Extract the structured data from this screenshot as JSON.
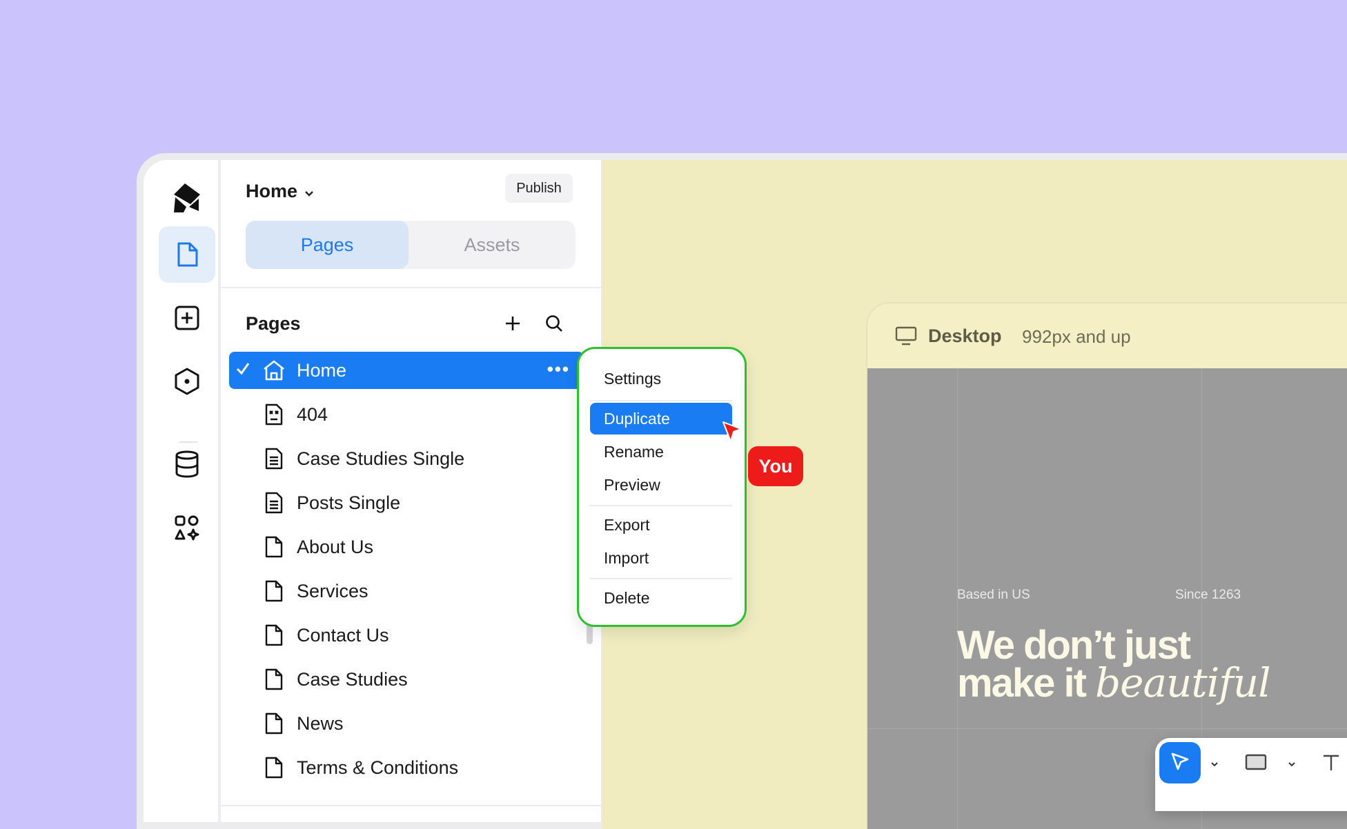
{
  "app": {
    "current_page": "Home",
    "publish_label": "Publish"
  },
  "panel": {
    "tabs": [
      {
        "label": "Pages",
        "active": true
      },
      {
        "label": "Assets",
        "active": false
      }
    ],
    "section_title": "Pages",
    "pages": [
      {
        "label": "Home",
        "icon": "home-icon",
        "selected": true
      },
      {
        "label": "404",
        "icon": "error-page-icon"
      },
      {
        "label": "Case Studies Single",
        "icon": "template-page-icon"
      },
      {
        "label": "Posts Single",
        "icon": "template-page-icon"
      },
      {
        "label": "About Us",
        "icon": "page-icon"
      },
      {
        "label": "Services",
        "icon": "page-icon"
      },
      {
        "label": "Contact Us",
        "icon": "page-icon"
      },
      {
        "label": "Case Studies",
        "icon": "page-icon"
      },
      {
        "label": "News",
        "icon": "page-icon"
      },
      {
        "label": "Terms & Conditions",
        "icon": "page-icon"
      }
    ]
  },
  "context_menu": {
    "items": [
      "Settings",
      "Duplicate",
      "Rename",
      "Preview",
      "Export",
      "Import",
      "Delete"
    ],
    "highlighted": "Duplicate"
  },
  "cursor_label": "You",
  "canvas": {
    "breakpoint_name": "Desktop",
    "breakpoint_desc": "992px and up",
    "left_caption": "Based in US",
    "right_caption": "Since 1263",
    "hero_line1": "We don’t just",
    "hero_line2_plain": "make it",
    "hero_line2_italic": "beautiful"
  },
  "colors": {
    "accent": "#1a7cf3",
    "background": "#cbc4fc",
    "canvas": "#f0ecc0",
    "menu_border": "#2bc12d",
    "cursor_badge": "#ee1b1b"
  }
}
